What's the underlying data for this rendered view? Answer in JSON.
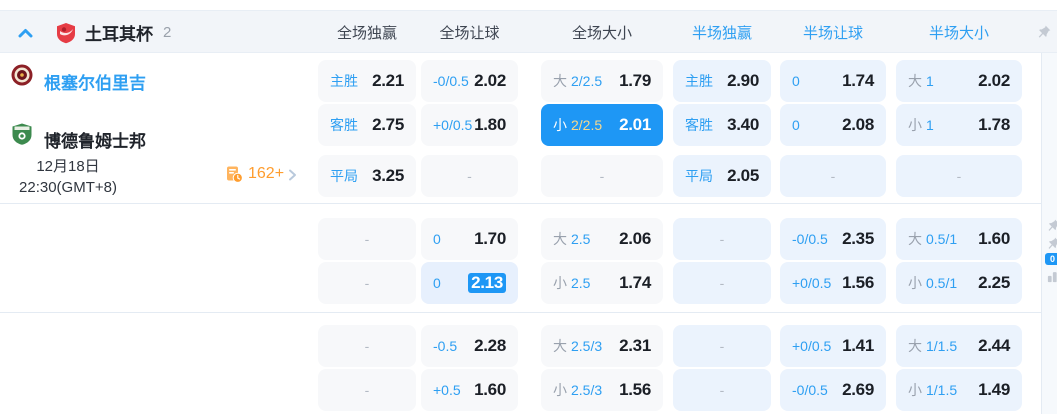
{
  "colors": {
    "accent_blue": "#2e9ff2",
    "selected_bg": "#1e97f5",
    "selected_line": "#f6d88e",
    "orange": "#ff9d2e",
    "ft_cell_bg": "#f7f8fa",
    "ht_cell_bg": "#ebf3fd"
  },
  "icons": {
    "collapse": "chevron-up",
    "league_logo": "red-shield",
    "pin": "pushpin",
    "more_icon": "doc-clock",
    "more_arrow": "chevron-right",
    "sidebar": [
      "pushpin",
      "pushpin",
      "live-badge",
      "bar-chart"
    ]
  },
  "header": {
    "league": "土耳其杯",
    "match_count": "2",
    "columns": [
      "全场独赢",
      "全场让球",
      "全场大小",
      "半场独赢",
      "半场让球",
      "半场大小"
    ]
  },
  "match": {
    "home_team": "根塞尔伯里吉",
    "away_team": "博德鲁姆士邦",
    "date": "12月18日",
    "time": "22:30(GMT+8)",
    "more_markets": "162+"
  },
  "sidebar": {
    "live_badge": "0"
  },
  "odds_rows": [
    {
      "cells": [
        {
          "label": "主胜",
          "value": "2.21"
        },
        {
          "label": "-0/0.5",
          "value": "2.02"
        },
        {
          "prefix": "大",
          "label": "2/2.5",
          "value": "1.79"
        },
        {
          "label": "主胜",
          "value": "2.90"
        },
        {
          "label": "0",
          "value": "1.74"
        },
        {
          "prefix": "大",
          "label": "1",
          "value": "2.02"
        }
      ]
    },
    {
      "cells": [
        {
          "label": "客胜",
          "value": "2.75"
        },
        {
          "label": "+0/0.5",
          "value": "1.80"
        },
        {
          "prefix": "小",
          "label": "2/2.5",
          "value": "2.01",
          "selected": true
        },
        {
          "label": "客胜",
          "value": "3.40"
        },
        {
          "label": "0",
          "value": "2.08"
        },
        {
          "prefix": "小",
          "label": "1",
          "value": "1.78"
        }
      ]
    },
    {
      "cells": [
        {
          "label": "平局",
          "value": "3.25"
        },
        {
          "dash": "-"
        },
        {
          "dash": "-"
        },
        {
          "label": "平局",
          "value": "2.05"
        },
        {
          "dash": "-"
        },
        {
          "dash": "-"
        }
      ]
    },
    {
      "cells": [
        {
          "dash": "-"
        },
        {
          "label": "0",
          "value": "1.70"
        },
        {
          "prefix": "大",
          "label": "2.5",
          "value": "2.06"
        },
        {
          "dash": "-"
        },
        {
          "label": "-0/0.5",
          "value": "2.35"
        },
        {
          "prefix": "大",
          "label": "0.5/1",
          "value": "1.60"
        }
      ]
    },
    {
      "cells": [
        {
          "dash": "-"
        },
        {
          "label": "0",
          "value": "2.13",
          "flash": true
        },
        {
          "prefix": "小",
          "label": "2.5",
          "value": "1.74"
        },
        {
          "dash": "-"
        },
        {
          "label": "+0/0.5",
          "value": "1.56"
        },
        {
          "prefix": "小",
          "label": "0.5/1",
          "value": "2.25"
        }
      ]
    },
    {
      "cells": [
        {
          "dash": "-"
        },
        {
          "label": "-0.5",
          "value": "2.28"
        },
        {
          "prefix": "大",
          "label": "2.5/3",
          "value": "2.31"
        },
        {
          "dash": "-"
        },
        {
          "label": "+0/0.5",
          "value": "1.41"
        },
        {
          "prefix": "大",
          "label": "1/1.5",
          "value": "2.44"
        }
      ]
    },
    {
      "cells": [
        {
          "dash": "-"
        },
        {
          "label": "+0.5",
          "value": "1.60"
        },
        {
          "prefix": "小",
          "label": "2.5/3",
          "value": "1.56"
        },
        {
          "dash": "-"
        },
        {
          "label": "-0/0.5",
          "value": "2.69"
        },
        {
          "prefix": "小",
          "label": "1/1.5",
          "value": "1.49"
        }
      ]
    }
  ]
}
